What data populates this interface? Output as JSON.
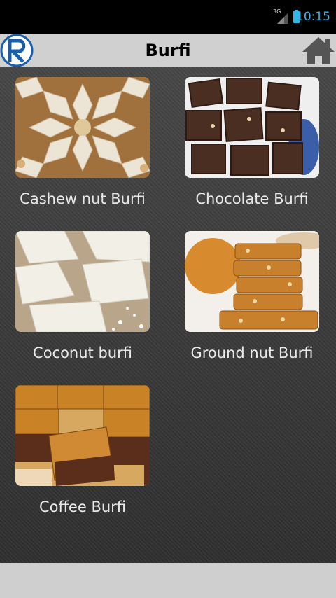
{
  "status_bar": {
    "network_label": "3G",
    "time": "10:15",
    "accent_color": "#33b5e5"
  },
  "action_bar": {
    "title": "Burfi",
    "logo_icon": "r-logo-icon",
    "home_icon": "home-icon"
  },
  "items": [
    {
      "label": "Cashew nut Burfi"
    },
    {
      "label": "Chocolate Burfi"
    },
    {
      "label": "Coconut burfi"
    },
    {
      "label": "Ground nut Burfi"
    },
    {
      "label": "Coffee Burfi"
    }
  ]
}
